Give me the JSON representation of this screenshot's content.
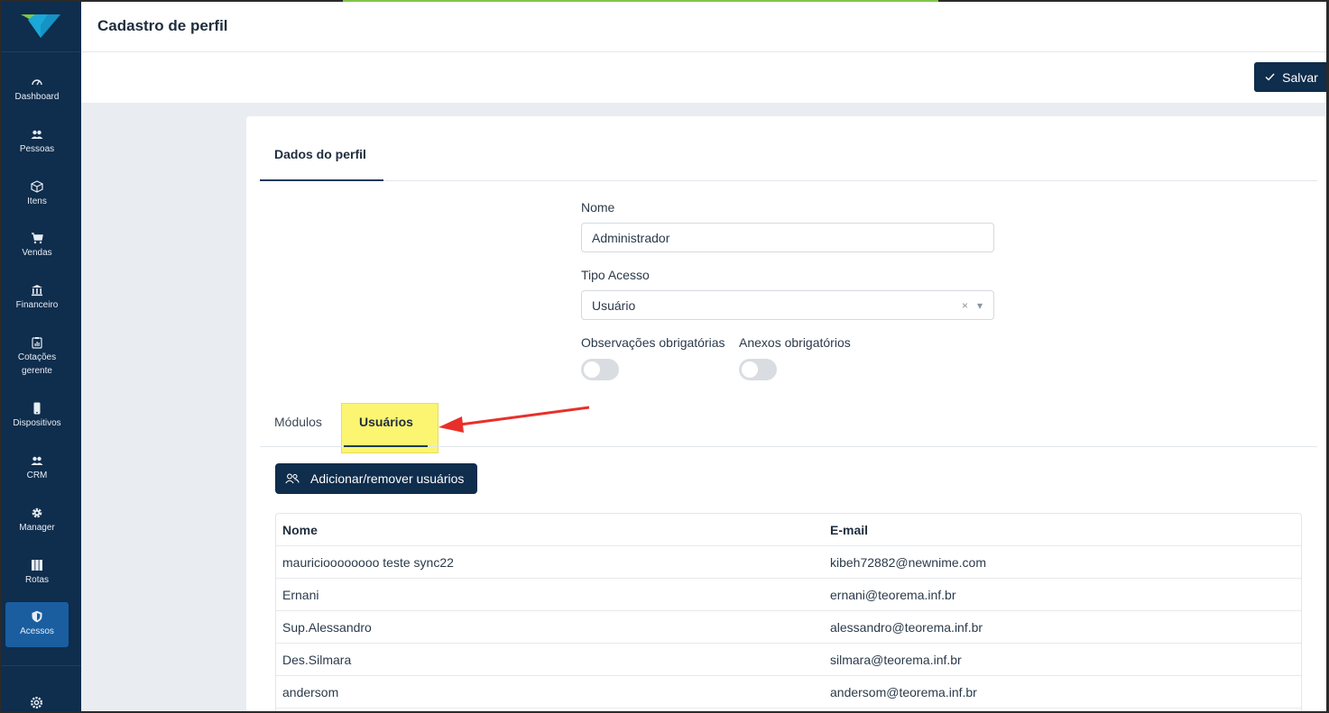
{
  "app": {
    "page_title": "Cadastro de perfil",
    "save_label": "Salvar"
  },
  "sidebar": {
    "items": [
      {
        "label": "Dashboard",
        "icon": "dashboard-icon"
      },
      {
        "label": "Pessoas",
        "icon": "people-icon"
      },
      {
        "label": "Itens",
        "icon": "box-icon"
      },
      {
        "label": "Vendas",
        "icon": "cart-icon"
      },
      {
        "label": "Financeiro",
        "icon": "bank-icon"
      },
      {
        "label": "Cotações gerente",
        "icon": "clipboard-chart-icon"
      },
      {
        "label": "Dispositivos",
        "icon": "phone-icon"
      },
      {
        "label": "CRM",
        "icon": "people-icon"
      },
      {
        "label": "Manager",
        "icon": "gear-icon"
      },
      {
        "label": "Rotas",
        "icon": "columns-icon"
      },
      {
        "label": "Acessos",
        "icon": "shield-icon",
        "active": true
      }
    ],
    "footer_icon": "settings-icon"
  },
  "form": {
    "tab_label": "Dados do perfil",
    "name_label": "Nome",
    "name_value": "Administrador",
    "access_label": "Tipo Acesso",
    "access_value": "Usuário",
    "obs_label": "Observações obrigatórias",
    "anexos_label": "Anexos obrigatórios",
    "obs_on": false,
    "anexos_on": false
  },
  "subtabs": {
    "modulos": "Módulos",
    "usuarios": "Usuários",
    "active": "Usuários"
  },
  "users": {
    "add_button": "Adicionar/remover usuários",
    "columns": [
      "Nome",
      "E-mail"
    ],
    "rows": [
      {
        "name": "mauricioooooooo teste sync22",
        "email": "kibeh72882@newnime.com"
      },
      {
        "name": "Ernani",
        "email": "ernani@teorema.inf.br"
      },
      {
        "name": "Sup.Alessandro",
        "email": "alessandro@teorema.inf.br"
      },
      {
        "name": "Des.Silmara",
        "email": "silmara@teorema.inf.br"
      },
      {
        "name": "andersom",
        "email": "andersom@teorema.inf.br"
      }
    ]
  },
  "colors": {
    "sidebar": "#0f2d4c",
    "active": "#1a5ea0",
    "highlight": "#fbf45a",
    "arrow": "#e8302a"
  }
}
